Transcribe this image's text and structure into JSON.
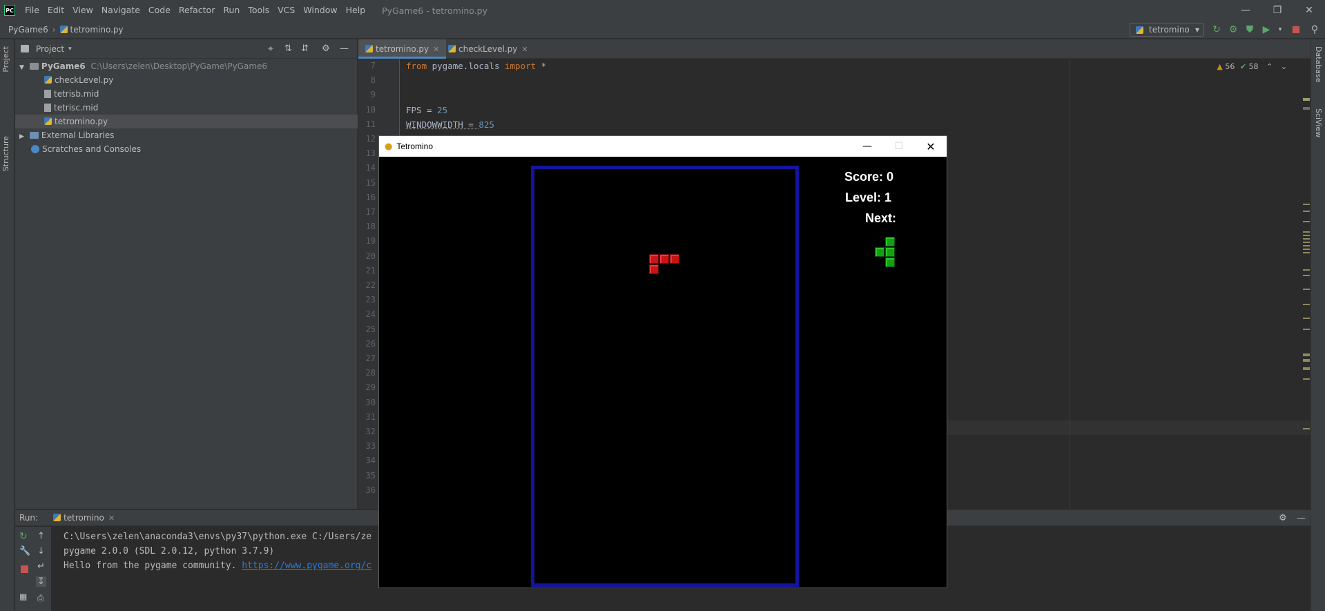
{
  "titlebar": {
    "logo": "PC",
    "menu": [
      "File",
      "Edit",
      "View",
      "Navigate",
      "Code",
      "Refactor",
      "Run",
      "Tools",
      "VCS",
      "Window",
      "Help"
    ],
    "window_title": "PyGame6 - tetromino.py"
  },
  "navbar": {
    "project": "PyGame6",
    "file": "tetromino.py",
    "run_config": "tetromino"
  },
  "left_strip": {
    "project_tab": "Project",
    "structure_tab": "Structure"
  },
  "right_strip": {
    "database_tab": "Database",
    "sciview_tab": "SciView"
  },
  "project_panel": {
    "header": "Project",
    "root_name": "PyGame6",
    "root_path": "C:\\Users\\zelen\\Desktop\\PyGame\\PyGame6",
    "files": [
      "checkLevel.py",
      "tetrisb.mid",
      "tetrisc.mid",
      "tetromino.py"
    ],
    "external": "External Libraries",
    "scratches": "Scratches and Consoles"
  },
  "editor": {
    "tabs": [
      "tetromino.py",
      "checkLevel.py"
    ],
    "inspections": {
      "warnings": "56",
      "ok": "58"
    },
    "line_numbers": [
      "7",
      "8",
      "9",
      "10",
      "11",
      "12",
      "13",
      "14",
      "15",
      "16",
      "17",
      "18",
      "19",
      "20",
      "21",
      "22",
      "23",
      "24",
      "25",
      "26",
      "27",
      "28",
      "29",
      "30",
      "31",
      "32",
      "33",
      "34",
      "35",
      "36"
    ],
    "code": {
      "l7_kw1": "from",
      "l7_mod": " pygame.locals ",
      "l7_kw2": "import",
      "l7_rest": " *",
      "l10_name": "FPS = ",
      "l10_val": "25",
      "l11_name": "WINDOWWIDTH = ",
      "l11_val": "825"
    }
  },
  "run_panel": {
    "label": "Run:",
    "tab": "tetromino",
    "output": [
      "C:\\Users\\zelen\\anaconda3\\envs\\py37\\python.exe C:/Users/ze",
      "pygame 2.0.0 (SDL 2.0.12, python 3.7.9)",
      "Hello from the pygame community. "
    ],
    "link": "https://www.pygame.org/c"
  },
  "game": {
    "title": "Tetromino",
    "score_label": "Score: 0",
    "level_label": "Level: 1",
    "next_label": "Next:",
    "board_color": "#1414a0",
    "falling_piece_color": "#c81414",
    "next_piece_color": "#14a014"
  }
}
